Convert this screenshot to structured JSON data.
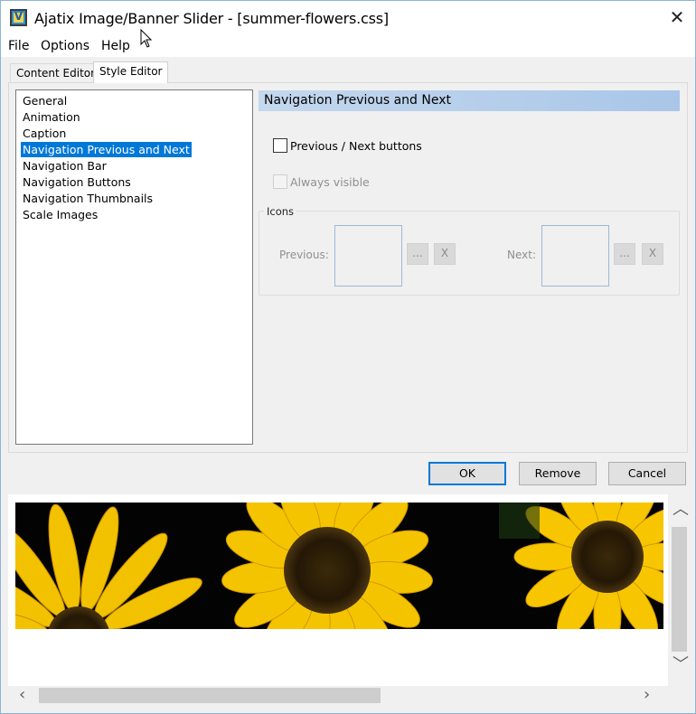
{
  "window": {
    "title": "Ajatix Image/Banner Slider - [summer-flowers.css]",
    "close_glyph": "✕"
  },
  "menu": [
    "File",
    "Options",
    "Help"
  ],
  "tabs": [
    {
      "label": "Content Editor",
      "active": false
    },
    {
      "label": "Style Editor",
      "active": true
    }
  ],
  "sidebar": {
    "items": [
      {
        "label": "General",
        "selected": false
      },
      {
        "label": "Animation",
        "selected": false
      },
      {
        "label": "Caption",
        "selected": false
      },
      {
        "label": "Navigation Previous and Next",
        "selected": true
      },
      {
        "label": "Navigation Bar",
        "selected": false
      },
      {
        "label": "Navigation Buttons",
        "selected": false
      },
      {
        "label": "Navigation Thumbnails",
        "selected": false
      },
      {
        "label": "Scale Images",
        "selected": false
      }
    ]
  },
  "panel": {
    "header": "Navigation Previous and Next",
    "prev_next_label": "Previous / Next buttons",
    "prev_next_checked": false,
    "always_visible_label": "Always visible",
    "always_visible_checked": false,
    "icons_group_label": "Icons",
    "previous_label": "Previous:",
    "next_label": "Next:",
    "browse_label": "...",
    "clear_label": "X"
  },
  "buttons": {
    "ok": "OK",
    "remove": "Remove",
    "cancel": "Cancel"
  },
  "preview": {
    "image": "sunflowers-banner"
  },
  "colors": {
    "selection": "#0078d7",
    "header_gradient": "#a9c6e8",
    "sunflower_petal": "#f5c400",
    "sunflower_center": "#2a1a08"
  }
}
